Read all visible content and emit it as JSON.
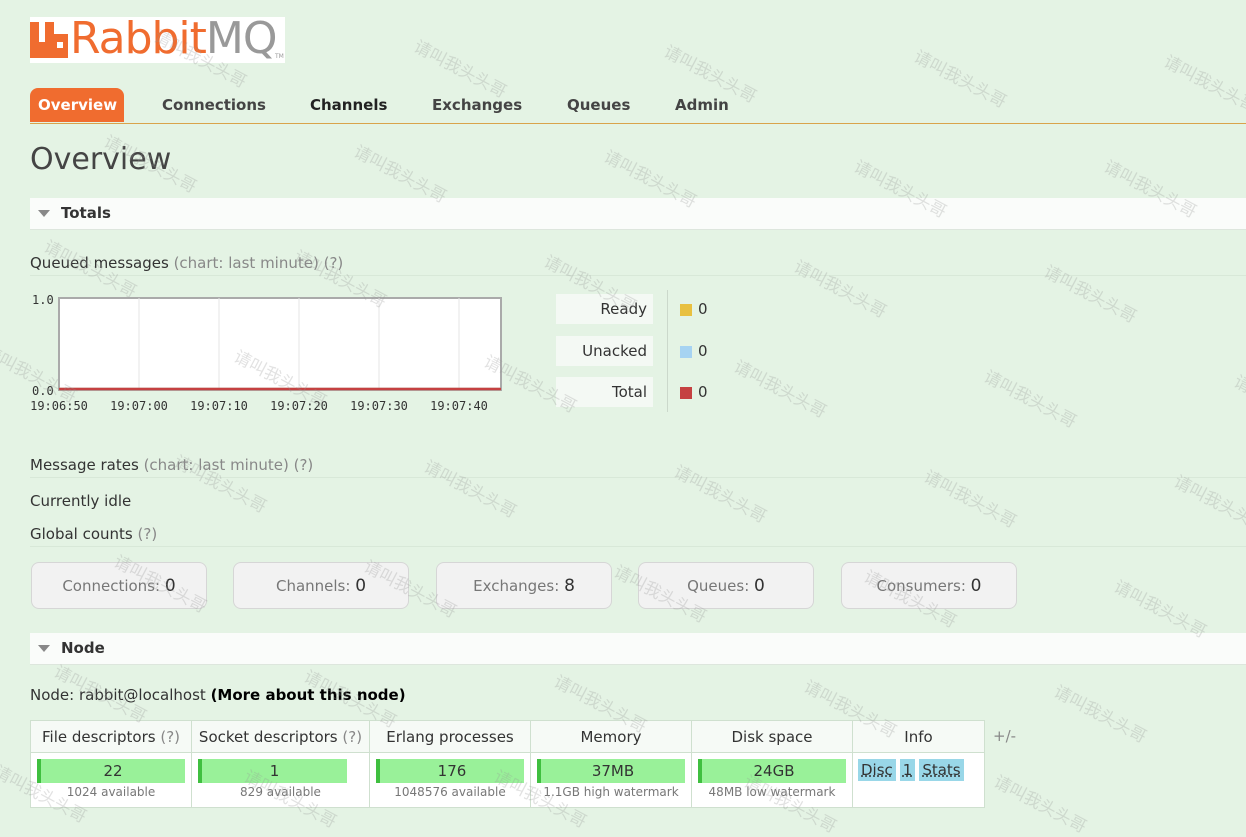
{
  "app": {
    "logo_brand": "Rabbit",
    "logo_product": "MQ",
    "logo_tm": "TM",
    "brand_color": "#f06c2f"
  },
  "nav": {
    "tabs": [
      "Overview",
      "Connections",
      "Channels",
      "Exchanges",
      "Queues",
      "Admin"
    ],
    "active": "Overview"
  },
  "page_title": "Overview",
  "totals": {
    "section_title": "Totals",
    "queued_label": "Queued messages",
    "queued_hint": "(chart: last minute) (?)",
    "legend": [
      {
        "label": "Ready",
        "value": "0",
        "color": "#e8c040"
      },
      {
        "label": "Unacked",
        "value": "0",
        "color": "#a6d3f2"
      },
      {
        "label": "Total",
        "value": "0",
        "color": "#c54141"
      }
    ],
    "rates_label": "Message rates",
    "rates_hint": "(chart: last minute) (?)",
    "idle_text": "Currently idle",
    "global_label": "Global counts",
    "global_hint": "(?)",
    "counts": [
      {
        "label": "Connections:",
        "value": "0"
      },
      {
        "label": "Channels:",
        "value": "0"
      },
      {
        "label": "Exchanges:",
        "value": "8"
      },
      {
        "label": "Queues:",
        "value": "0"
      },
      {
        "label": "Consumers:",
        "value": "0"
      }
    ]
  },
  "chart_data": {
    "type": "line",
    "title": "",
    "x": [
      "19:06:50",
      "19:07:00",
      "19:07:10",
      "19:07:20",
      "19:07:30",
      "19:07:40"
    ],
    "y_ticks": [
      "1.0",
      "0.0"
    ],
    "ylim": [
      0,
      1
    ],
    "series": [
      {
        "name": "Ready",
        "values": [
          0,
          0,
          0,
          0,
          0,
          0
        ]
      },
      {
        "name": "Unacked",
        "values": [
          0,
          0,
          0,
          0,
          0,
          0
        ]
      },
      {
        "name": "Total",
        "values": [
          0,
          0,
          0,
          0,
          0,
          0
        ]
      }
    ],
    "grid": true
  },
  "node": {
    "section_title": "Node",
    "label": "Node:",
    "name": "rabbit@localhost",
    "more_link": "(More about this node)",
    "columns": [
      {
        "title": "File descriptors",
        "hint": "(?)"
      },
      {
        "title": "Socket descriptors",
        "hint": "(?)"
      },
      {
        "title": "Erlang processes",
        "hint": ""
      },
      {
        "title": "Memory",
        "hint": ""
      },
      {
        "title": "Disk space",
        "hint": ""
      },
      {
        "title": "Info",
        "hint": ""
      }
    ],
    "values": [
      {
        "value": "22",
        "sub": "1024 available"
      },
      {
        "value": "1",
        "sub": "829 available"
      },
      {
        "value": "176",
        "sub": "1048576 available"
      },
      {
        "value": "37MB",
        "sub": "1.1GB high watermark"
      },
      {
        "value": "24GB",
        "sub": "48MB low watermark"
      }
    ],
    "info_tags": [
      "Disc",
      "1",
      "Stats"
    ],
    "plus_minus": "+/-"
  },
  "watermark_text": "请叫我头头哥"
}
